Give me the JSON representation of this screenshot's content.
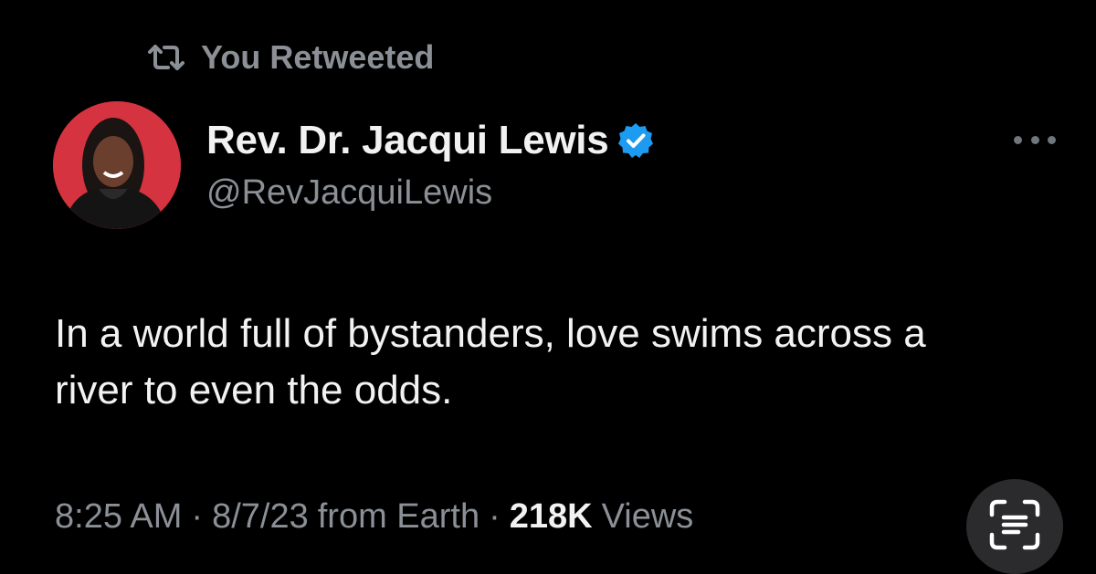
{
  "retweet_banner": {
    "icon": "retweet-icon",
    "label": "You Retweeted"
  },
  "author": {
    "name": "Rev. Dr. Jacqui Lewis",
    "handle": "@RevJacquiLewis",
    "verified_icon": "verified-badge-icon",
    "verified_color": "#1d9bf0"
  },
  "more_icon": "more-options-icon",
  "tweet": {
    "text": "In a world full of bystanders, love swims across a river to even the odds."
  },
  "meta": {
    "time": "8:25 AM",
    "date": "8/7/23",
    "source": "from Earth",
    "views_count": "218K",
    "views_label": "Views",
    "separator": "·"
  },
  "live_text_icon": "live-text-scan-icon",
  "colors": {
    "background": "#000000",
    "primary_text": "#f2f2f2",
    "secondary_text": "#8b9096",
    "avatar_bg": "#d4333f"
  }
}
